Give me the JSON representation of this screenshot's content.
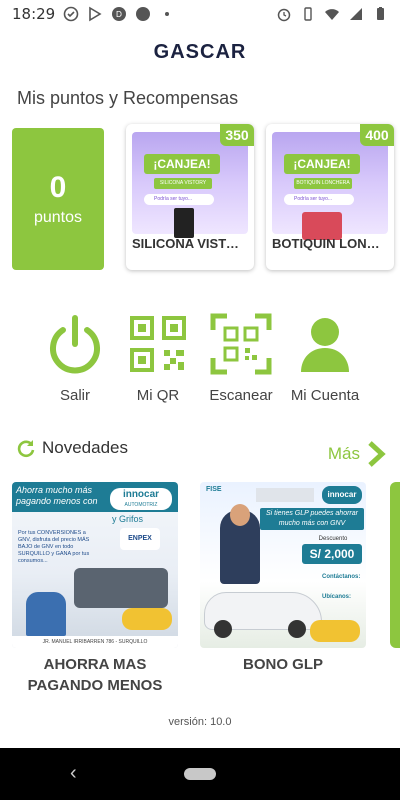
{
  "status": {
    "time": "18:29",
    "battery_icon": "battery-icon",
    "wifi_icon": "wifi-icon",
    "signal_icon": "signal-icon",
    "alarm_icon": "alarm-icon"
  },
  "app": {
    "title": "GASCAR"
  },
  "rewards_section": {
    "title": "Mis puntos y Recompensas"
  },
  "points": {
    "value": "0",
    "label": "puntos"
  },
  "rewards": [
    {
      "name": "SILICONA VISTORY",
      "price": "350",
      "badge": "¡CANJEA!",
      "sub": "SILICONA VISTORY",
      "pill": "Podría ser tuyo..."
    },
    {
      "name": "BOTIQUIN LONCHERA",
      "price": "400",
      "badge": "¡CANJEA!",
      "sub": "BOTIQUIN LONCHERA",
      "pill": "Podría ser tuyo..."
    }
  ],
  "menu": [
    {
      "label": "Salir",
      "icon": "power-icon"
    },
    {
      "label": "Mi QR",
      "icon": "qr-code-icon"
    },
    {
      "label": "Escanear",
      "icon": "qr-scan-icon"
    },
    {
      "label": "Mi Cuenta",
      "icon": "user-icon"
    }
  ],
  "news_section": {
    "title": "Novedades",
    "more": "Más"
  },
  "news": [
    {
      "title": "AHORRA MAS PAGANDO MENOS",
      "headline": "Ahorra mucho más pagando menos con",
      "brand": "innocar",
      "brand_sub": "AUTOMOTRIZ",
      "extra": "y Grifos",
      "body": "Por tus CONVERSIONES a GNV, disfruta del precio MÁS BAJO de GNV en todo SURQUILLO y GANA por tus consumos...",
      "partner": "ENPEX",
      "address": "JR. MANUEL IRRIBARREN 786 - SURQUILLO"
    },
    {
      "title": "BONO GLP",
      "headline": "Si tienes GLP puedes ahorrar mucho más con GNV",
      "label": "Descuento",
      "amount": "S/ 2,000",
      "contact": "Contáctanos:",
      "location": "Ubícanos:",
      "brand": "innocar",
      "fise": "FISE"
    }
  ],
  "version": "versión: 10.0",
  "colors": {
    "accent": "#8dc63f",
    "title": "#1b2240"
  }
}
